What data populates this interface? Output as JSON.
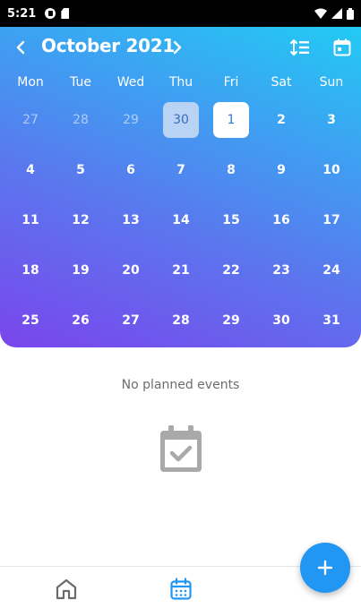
{
  "status_bar": {
    "time": "5:21"
  },
  "header": {
    "month_title": "October 2021"
  },
  "weekdays": [
    "Mon",
    "Tue",
    "Wed",
    "Thu",
    "Fri",
    "Sat",
    "Sun"
  ],
  "days": [
    {
      "label": "27",
      "state": "muted"
    },
    {
      "label": "28",
      "state": "muted"
    },
    {
      "label": "29",
      "state": "muted"
    },
    {
      "label": "30",
      "state": "selected"
    },
    {
      "label": "1",
      "state": "today"
    },
    {
      "label": "2",
      "state": "normal"
    },
    {
      "label": "3",
      "state": "normal"
    },
    {
      "label": "4",
      "state": "normal"
    },
    {
      "label": "5",
      "state": "normal"
    },
    {
      "label": "6",
      "state": "normal"
    },
    {
      "label": "7",
      "state": "normal"
    },
    {
      "label": "8",
      "state": "normal"
    },
    {
      "label": "9",
      "state": "normal"
    },
    {
      "label": "10",
      "state": "normal"
    },
    {
      "label": "11",
      "state": "normal"
    },
    {
      "label": "12",
      "state": "normal"
    },
    {
      "label": "13",
      "state": "normal"
    },
    {
      "label": "14",
      "state": "normal"
    },
    {
      "label": "15",
      "state": "normal"
    },
    {
      "label": "16",
      "state": "normal"
    },
    {
      "label": "17",
      "state": "normal"
    },
    {
      "label": "18",
      "state": "normal"
    },
    {
      "label": "19",
      "state": "normal"
    },
    {
      "label": "20",
      "state": "normal"
    },
    {
      "label": "21",
      "state": "normal"
    },
    {
      "label": "22",
      "state": "normal"
    },
    {
      "label": "23",
      "state": "normal"
    },
    {
      "label": "24",
      "state": "normal"
    },
    {
      "label": "25",
      "state": "normal"
    },
    {
      "label": "26",
      "state": "normal"
    },
    {
      "label": "27",
      "state": "normal"
    },
    {
      "label": "28",
      "state": "normal"
    },
    {
      "label": "29",
      "state": "normal"
    },
    {
      "label": "30",
      "state": "normal"
    },
    {
      "label": "31",
      "state": "normal"
    }
  ],
  "empty_state": {
    "text": "No planned events",
    "icon": "calendar-check-icon"
  },
  "bottom_nav": {
    "tabs": [
      {
        "name": "home",
        "icon": "home-icon",
        "active": false
      },
      {
        "name": "calendar",
        "icon": "calendar-icon",
        "active": true
      }
    ]
  },
  "fab": {
    "icon": "plus-icon"
  },
  "colors": {
    "accent": "#2196f3",
    "gradient_start": "#1dd3f5",
    "gradient_end": "#7a45ec",
    "today_text": "#2b7be4",
    "selected_bg": "#b9d3f5"
  }
}
